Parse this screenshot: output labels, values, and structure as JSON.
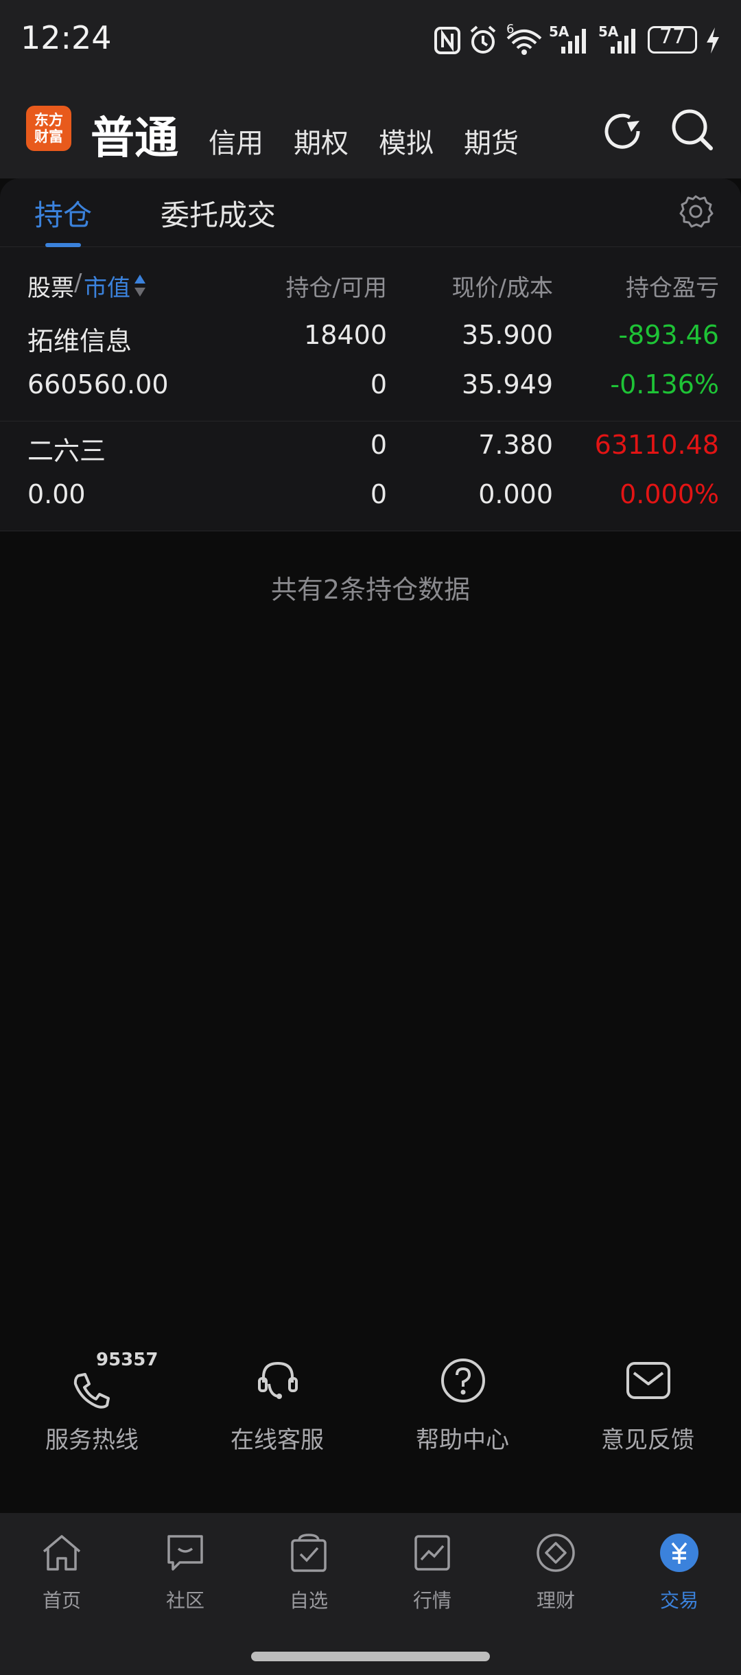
{
  "status": {
    "time": "12:24",
    "network1": "5A",
    "network2": "5A",
    "battery": "77",
    "wifi_tag": "6"
  },
  "brand": {
    "logo_line1": "东方",
    "logo_line2": "财富"
  },
  "header": {
    "active_tab": "普通",
    "tabs": [
      "信用",
      "期权",
      "模拟",
      "期货"
    ]
  },
  "subtabs": {
    "holdings": "持仓",
    "orders": "委托成交"
  },
  "columns": {
    "stock": "股票",
    "slash": "/",
    "market_value": "市值",
    "position": "持仓/可用",
    "price": "现价/成本",
    "pnl": "持仓盈亏"
  },
  "holdings": [
    {
      "name": "拓维信息",
      "market_value": "660560.00",
      "position": "18400",
      "available": "0",
      "price": "35.900",
      "cost": "35.949",
      "pnl": "-893.46",
      "pnl_pct": "-0.136%",
      "pnl_color": "#1ec336"
    },
    {
      "name": "二六三",
      "market_value": "0.00",
      "position": "0",
      "available": "0",
      "price": "7.380",
      "cost": "0.000",
      "pnl": "63110.48",
      "pnl_pct": "0.000%",
      "pnl_color": "#e21414"
    }
  ],
  "summary": "共有2条持仓数据",
  "services": [
    {
      "label": "服务热线",
      "icon": "phone-icon",
      "badge": "95357"
    },
    {
      "label": "在线客服",
      "icon": "headset-icon"
    },
    {
      "label": "帮助中心",
      "icon": "help-icon"
    },
    {
      "label": "意见反馈",
      "icon": "mail-icon"
    }
  ],
  "nav": [
    {
      "label": "首页",
      "icon": "home-icon"
    },
    {
      "label": "社区",
      "icon": "community-icon"
    },
    {
      "label": "自选",
      "icon": "watchlist-icon"
    },
    {
      "label": "行情",
      "icon": "market-icon"
    },
    {
      "label": "理财",
      "icon": "wealth-icon"
    },
    {
      "label": "交易",
      "icon": "trade-icon",
      "active": true
    }
  ],
  "colors": {
    "accent": "#3b82dc",
    "loss": "#1ec336",
    "gain": "#e21414",
    "brand": "#e85a1c"
  }
}
